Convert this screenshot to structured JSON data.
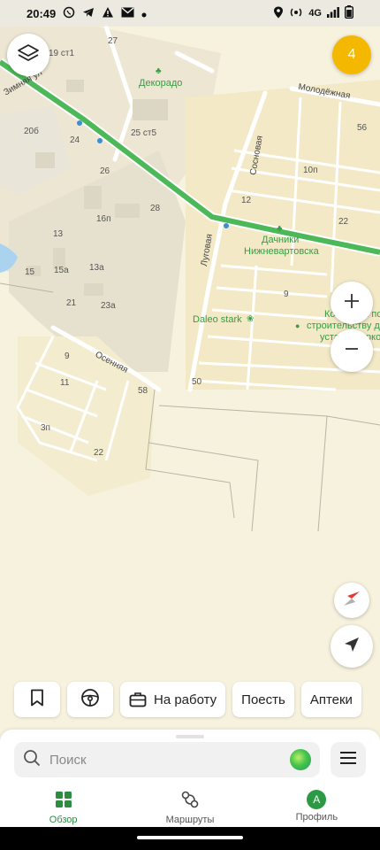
{
  "status_bar": {
    "time": "20:49",
    "network": "4G"
  },
  "map": {
    "badge_count": "4",
    "house_numbers": [
      "27",
      "19 ст1",
      "20б",
      "24",
      "25 ст5",
      "26",
      "28",
      "16п",
      "13",
      "13а",
      "15",
      "15а",
      "21",
      "23а",
      "9",
      "11",
      "3п",
      "58",
      "22",
      "56",
      "10п",
      "12",
      "22",
      "9",
      "50"
    ],
    "streets": {
      "molodezhnaya": "Молодёжная",
      "sosnovaya": "Сосновая",
      "lugovaya": "Луговая",
      "osennyaya": "Осенняя",
      "top_left": "Зимняя ул"
    },
    "pois": {
      "dekorado": "Декорадо",
      "dachniki_line1": "Дачники",
      "dachniki_line2": "Нижневартовска",
      "daleo": "Daleo stark",
      "company_line1": "Компания по",
      "company_line2": "строительству д",
      "company_line3": "устан... ворко"
    }
  },
  "chips": {
    "to_work": "На работу",
    "eat": "Поесть",
    "pharmacies": "Аптеки"
  },
  "search": {
    "placeholder": "Поиск"
  },
  "nav": {
    "overview": "Обзор",
    "routes": "Маршруты",
    "profile": "Профиль",
    "avatar_letter": "А"
  },
  "colors": {
    "accent_green": "#2c8c3f",
    "route_green": "#4cb858",
    "badge_yellow": "#f5b800",
    "map_background": "#f7f2de"
  }
}
